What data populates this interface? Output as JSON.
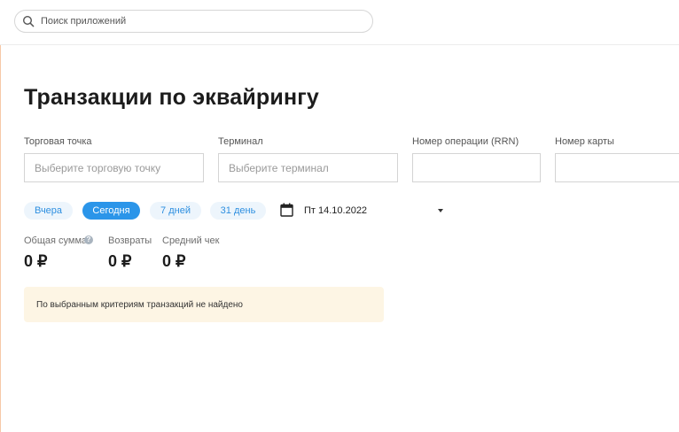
{
  "search": {
    "placeholder": "Поиск приложений"
  },
  "page": {
    "title": "Транзакции по эквайрингу"
  },
  "filters": {
    "outlet": {
      "label": "Торговая точка",
      "placeholder": "Выберите торговую точку"
    },
    "terminal": {
      "label": "Терминал",
      "placeholder": "Выберите терминал"
    },
    "rrn": {
      "label": "Номер операции (RRN)",
      "value": ""
    },
    "card": {
      "label": "Номер карты",
      "value": ""
    }
  },
  "periods": [
    {
      "label": "Вчера",
      "active": false
    },
    {
      "label": "Сегодня",
      "active": true
    },
    {
      "label": "7 дней",
      "active": false
    },
    {
      "label": "31 день",
      "active": false
    }
  ],
  "date": {
    "value": "Пт 14.10.2022"
  },
  "stats": {
    "total": {
      "label": "Общая сумма",
      "value": "0 ₽"
    },
    "returns": {
      "label": "Возвраты",
      "value": "0 ₽"
    },
    "avg": {
      "label": "Средний чек",
      "value": "0 ₽"
    }
  },
  "notice": {
    "text": "По выбранным критериям транзакций не найдено"
  },
  "colors": {
    "accent": "#2b95e9",
    "chip_bg": "#edf5fc",
    "notice_bg": "#fdf5e4"
  },
  "icons": {
    "search": "search-icon",
    "calendar": "calendar-icon",
    "dropdown": "caret-down-icon",
    "help": "help-icon"
  }
}
